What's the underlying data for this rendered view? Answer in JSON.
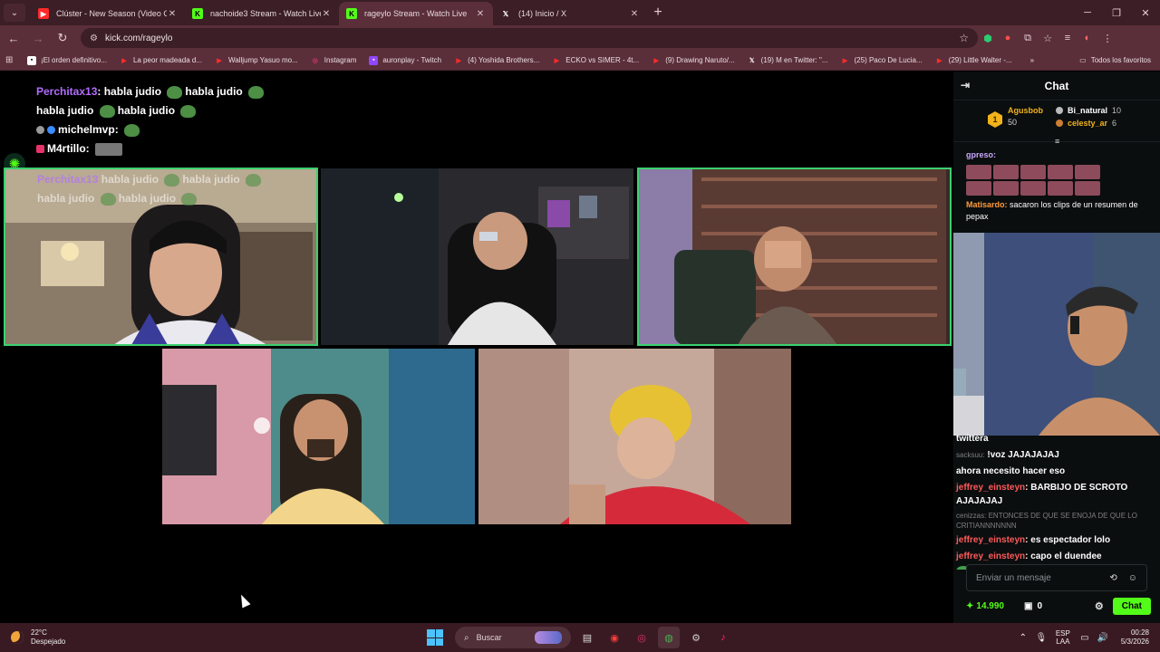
{
  "browser": {
    "tabs": [
      {
        "title": "Clúster - New Season (Video O",
        "favicon_color": "#ff2a2a",
        "favicon_glyph": "▶",
        "active": false
      },
      {
        "title": "nachoide3 Stream - Watch Live",
        "favicon_color": "#53fc18",
        "favicon_glyph": "K",
        "active": false
      },
      {
        "title": "rageylo Stream - Watch Live",
        "favicon_color": "#53fc18",
        "favicon_glyph": "K",
        "active": true
      },
      {
        "title": "(14) Inicio / X",
        "favicon_color": "#000000",
        "favicon_glyph": "𝕏",
        "active": false
      }
    ],
    "url": "kick.com/rageylo",
    "bookmarks": [
      {
        "label": "¡El orden definitivo...",
        "color": "#ffffff",
        "glyph": "▪"
      },
      {
        "label": "La peor madeada d...",
        "color": "#ff2a2a",
        "glyph": "▶"
      },
      {
        "label": "Walljump Yasuo mo...",
        "color": "#ff2a2a",
        "glyph": "▶"
      },
      {
        "label": "Instagram",
        "color": "#e1306c",
        "glyph": "◎"
      },
      {
        "label": "auronplay - Twitch",
        "color": "#9146ff",
        "glyph": "▪"
      },
      {
        "label": "(4) Yoshida Brothers...",
        "color": "#ff2a2a",
        "glyph": "▶"
      },
      {
        "label": "ECKO vs SIMER - 4t...",
        "color": "#ff2a2a",
        "glyph": "▶"
      },
      {
        "label": "(9) Drawing Naruto/...",
        "color": "#ff2a2a",
        "glyph": "▶"
      },
      {
        "label": "(19) M en Twitter: \"...",
        "color": "#000000",
        "glyph": "𝕏"
      },
      {
        "label": "(25) Paco De Lucia...",
        "color": "#ff2a2a",
        "glyph": "▶"
      },
      {
        "label": "(29) Little Walter -...",
        "color": "#ff2a2a",
        "glyph": "▶"
      }
    ],
    "all_bookmarks_label": "Todos los favoritos"
  },
  "overlay_chat": [
    {
      "user": "Perchitax13",
      "text": ": habla judio",
      "emote_text": "habla judio",
      "user_color": "#b26dff"
    },
    {
      "user": "",
      "text": "habla judio",
      "emote_text": "habla judio",
      "user_color": "#ffffff"
    },
    {
      "user": "michelmvp:",
      "text": "",
      "user_color": "#ffffff"
    },
    {
      "user": "M4rtillo:",
      "text": "",
      "user_color": "#ffffff"
    }
  ],
  "cam_overlay": {
    "user": "Perchitax13",
    "line1": "habla judio",
    "line1b": "habla judio",
    "line2": "habla judio",
    "line2b": "habla judio"
  },
  "chat": {
    "title": "Chat",
    "top_gifter": {
      "rank": "1",
      "name": "Agusbob",
      "count": "50"
    },
    "gifters": [
      {
        "name": "Bi_natural",
        "count": "10",
        "color": "#ffffff"
      },
      {
        "name": "celesty_ar",
        "count": "6",
        "color": "#f2b21a"
      }
    ],
    "messages": [
      {
        "user": "gpreso:",
        "text": "",
        "color": "#c9a8ff"
      },
      {
        "user": "Matisardo:",
        "text": "sacaron los clips de un resumen de pepax",
        "color": "#ff9a3c"
      }
    ],
    "lower_messages": [
      {
        "prefix": "twittera",
        "text": ""
      },
      {
        "prefix": "sacksuu:",
        "text": "!voz JAJAJAJAJ"
      },
      {
        "prefix": "",
        "text": "ahora necesito hacer eso"
      },
      {
        "prefix": "jeffrey_einsteyn",
        "text": ": BARBIJO DE SCROTO AJAJAJAJ"
      },
      {
        "prefix": "cenizzas:",
        "text": "ENTONCES DE QUE SE ENOJA DE QUE LO CRITIANNNNNNN"
      },
      {
        "prefix": "jeffrey_einsteyn",
        "text": ": es espectador lolo"
      },
      {
        "prefix": "jeffrey_einsteyn",
        "text": ": capo el duendee"
      }
    ],
    "ghost_names": [
      "sacksuu:",
      "sacksuu:",
      "michelmvp:",
      "sacksuu:"
    ],
    "input_placeholder": "Enviar un mensaje",
    "kicks": "14.990",
    "subs": "0",
    "send_label": "Chat"
  },
  "taskbar": {
    "temp": "22°C",
    "weather": "Despejado",
    "search": "Buscar",
    "lang1": "ESP",
    "lang2": "LAA",
    "time": "00:28",
    "date": "5/3/2026"
  }
}
